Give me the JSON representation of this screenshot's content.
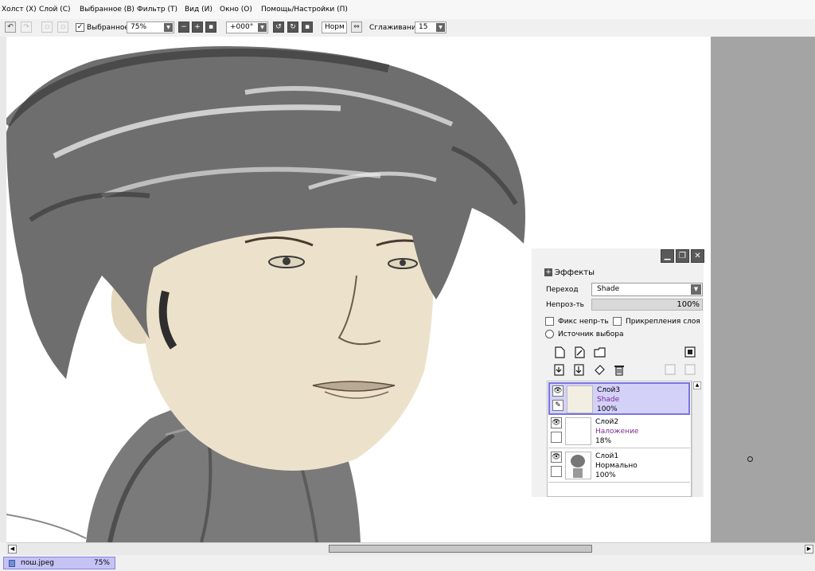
{
  "menu": [
    "Холст (Х)",
    "Слой (С)",
    "Выбранное (В)",
    "Фильтр (Т)",
    "Вид (И)",
    "Окно (О)",
    "Помощь/Настройки (П)"
  ],
  "toolbar": {
    "selected_label": "Выбранное",
    "zoom": "75%",
    "rotation": "+000°",
    "mode": "Норм",
    "smoothing_label": "Сглаживание",
    "smoothing_value": "15"
  },
  "panel": {
    "effects_label": "Эффекты",
    "transition_label": "Переход",
    "blend_mode": "Shade",
    "opacity_label": "Непроз-ть",
    "opacity_value": "100%",
    "fix_opacity_label": "Фикс непр-ть",
    "clipping_label": "Прикрепления слоя",
    "selection_source_label": "Источник выбора"
  },
  "layers": [
    {
      "name": "Слой3",
      "mode": "Shade",
      "opacity": "100%"
    },
    {
      "name": "Слой2",
      "mode": "Наложение",
      "opacity": "18%"
    },
    {
      "name": "Слой1",
      "mode": "Нормально",
      "opacity": "100%"
    }
  ],
  "document": {
    "filename": "пош.jpeg",
    "zoom": "75%"
  },
  "colors": {
    "selection": "#d4d1f9",
    "selection_border": "#7874e2",
    "blend_mode_text": "#7b2b8f",
    "skin_tone": "#ece2cc",
    "canvas_gray": "#a4a4a4"
  }
}
